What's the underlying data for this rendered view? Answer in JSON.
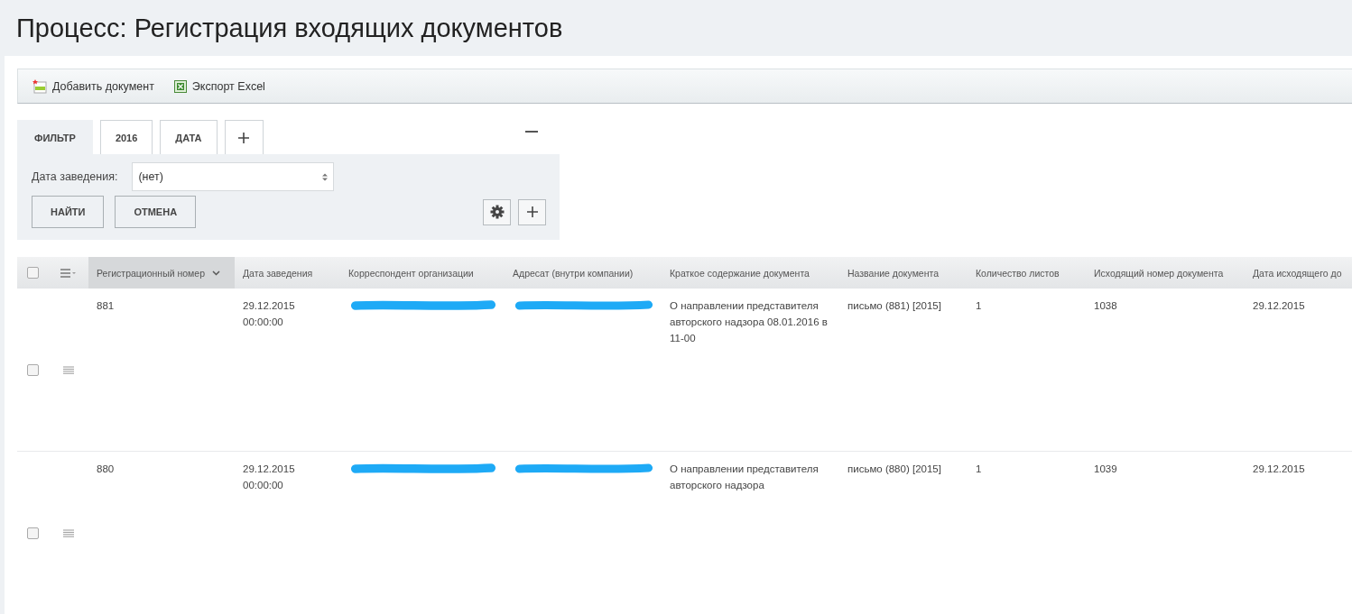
{
  "page_title": "Процесс: Регистрация входящих документов",
  "toolbar": [
    {
      "kind": "add",
      "label": "Добавить документ"
    },
    {
      "kind": "excel",
      "label": "Экспорт Excel"
    }
  ],
  "filter_tabs": [
    {
      "label": "ФИЛЬТР",
      "selected": true
    },
    {
      "label": "2016",
      "selected": false
    },
    {
      "label": "ДАТА",
      "selected": false
    }
  ],
  "filter": {
    "field_label": "Дата заведения:",
    "field_value": "(нет)",
    "buttons": [
      "НАЙТИ",
      "ОТМЕНА"
    ]
  },
  "table": {
    "select_all_checked": false,
    "columns": [
      {
        "label": "Регистрационный номер",
        "sorted": true
      },
      {
        "label": "Дата заведения",
        "sorted": false
      },
      {
        "label": "Корреспондент организации",
        "sorted": false
      },
      {
        "label": "Адресат (внутри компании)",
        "sorted": false
      },
      {
        "label": "Краткое содержание документа",
        "sorted": false
      },
      {
        "label": "Название документа",
        "sorted": false
      },
      {
        "label": "Количество листов",
        "sorted": false
      },
      {
        "label": "Исходящий номер документа",
        "sorted": false
      },
      {
        "label": "Дата исходящего до",
        "sorted": false
      }
    ],
    "rows": [
      {
        "checked": false,
        "cells": [
          {
            "text": "881"
          },
          {
            "text": "29.12.2015 00:00:00"
          },
          {
            "redacted": true
          },
          {
            "redacted": true
          },
          {
            "text": "О направлении представителя авторского надзора 08.01.2016 в 11-00"
          },
          {
            "text": "письмо (881) [2015]"
          },
          {
            "text": "1"
          },
          {
            "text": "1038"
          },
          {
            "text": "29.12.2015"
          }
        ]
      },
      {
        "checked": false,
        "cells": [
          {
            "text": "880"
          },
          {
            "text": "29.12.2015 00:00:00"
          },
          {
            "redacted": true
          },
          {
            "redacted": true
          },
          {
            "text": "О направлении представителя авторского надзора"
          },
          {
            "text": "письмо (880) [2015]"
          },
          {
            "text": "1"
          },
          {
            "text": "1039"
          },
          {
            "text": "29.12.2015"
          }
        ]
      }
    ]
  }
}
